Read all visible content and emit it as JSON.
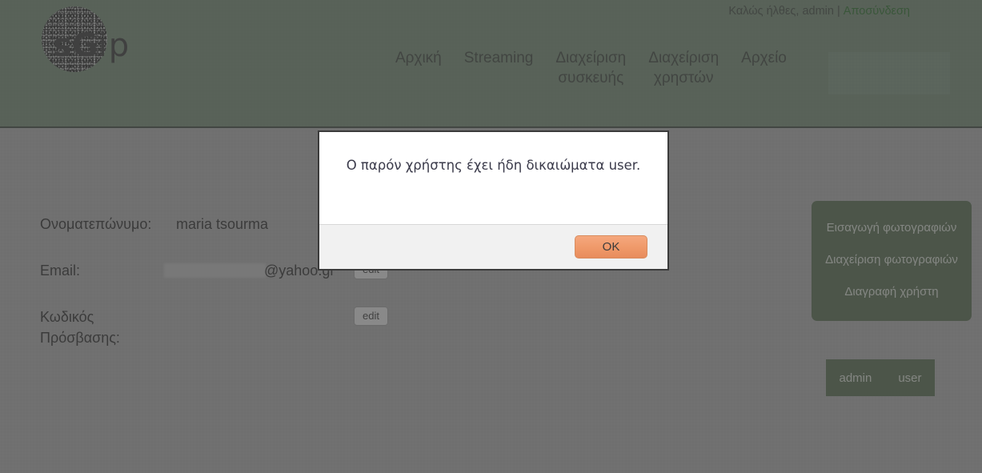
{
  "header": {
    "welcome_text": "Καλώς ήλθες, admin |",
    "logout_label": "Αποσύνδεση",
    "logo_main": "sG",
    "logo_suffix": "ip",
    "nav": [
      {
        "label": "Αρχική"
      },
      {
        "label": "Streaming"
      },
      {
        "label": "Διαχείριση\nσυσκευής"
      },
      {
        "label": "Διαχείριση\nχρηστών"
      },
      {
        "label": "Αρχείο"
      }
    ]
  },
  "profile": {
    "rows": [
      {
        "label": "Ονοματεπώνυμο:",
        "value": "maria tsourma",
        "edit_label": "",
        "email_domain": "",
        "redacted": false
      },
      {
        "label": "Email:",
        "value": "",
        "email_domain": "@yahoo.gr",
        "edit_label": "edit",
        "redacted": true
      },
      {
        "label": "Κωδικός\nΠρόσβασης:",
        "value": "",
        "email_domain": "",
        "edit_label": "edit",
        "redacted": false
      }
    ]
  },
  "side_panel": {
    "items": [
      {
        "label": "Εισαγωγή φωτογραφιών"
      },
      {
        "label": "Διαχείριση φωτογραφιών"
      },
      {
        "label": "Διαγραφή χρήστη"
      }
    ]
  },
  "role_box": {
    "admin_label": "admin",
    "user_label": "user"
  },
  "modal": {
    "message": "Ο παρόν χρήστης έχει ήδη δικαιώματα user.",
    "ok_label": "OK"
  },
  "colors": {
    "header_green": "#6f8570",
    "panel_green": "#56684f",
    "page_gray": "#a5a5a5",
    "logout_green": "#2d6b2d",
    "ok_orange": "#f09a6b"
  }
}
